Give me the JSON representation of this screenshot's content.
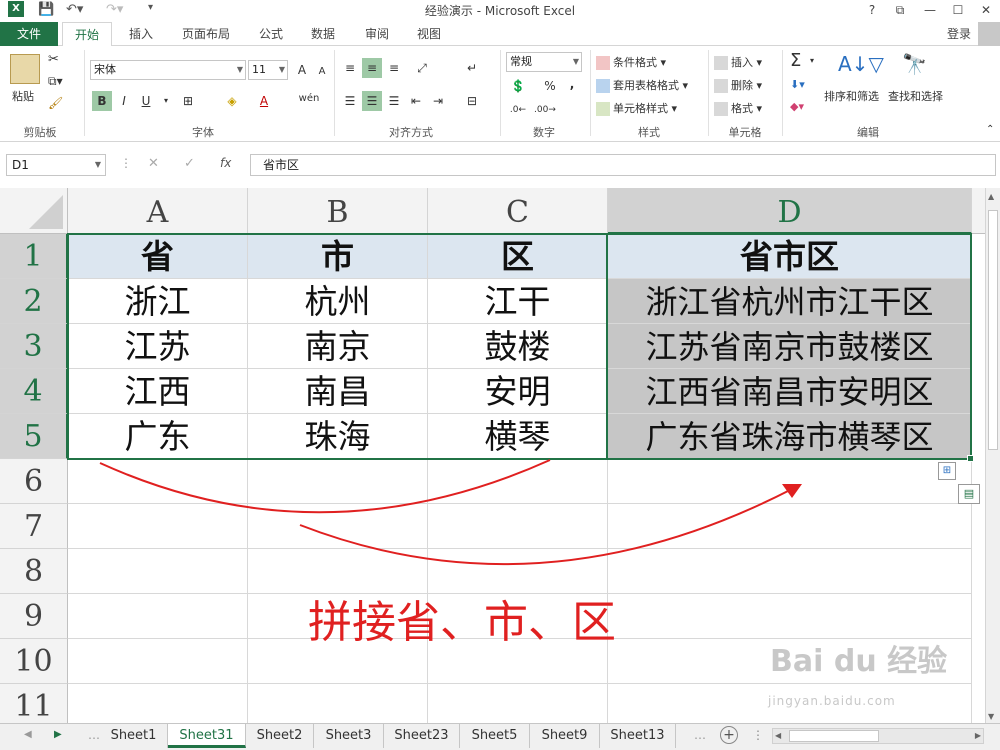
{
  "app": {
    "title": "经验演示 - Microsoft Excel",
    "login": "登录",
    "help": "?",
    "restore": "⧉",
    "minimize": "—",
    "close": "✕"
  },
  "tabs": [
    "文件",
    "开始",
    "插入",
    "页面布局",
    "公式",
    "数据",
    "审阅",
    "视图"
  ],
  "ribbon": {
    "clipboard": {
      "paste": "粘贴",
      "label": "剪贴板"
    },
    "font": {
      "name": "宋体",
      "size": "11",
      "grow": "A",
      "shrink": "A",
      "bold": "B",
      "italic": "I",
      "underline": "U",
      "fontcolor": "A",
      "phonetic": "wén",
      "label": "字体"
    },
    "alignment": {
      "label": "对齐方式"
    },
    "number": {
      "format": "常规",
      "percent": "%",
      "comma": ",",
      "label": "数字"
    },
    "styles": {
      "cond": "条件格式",
      "table": "套用表格格式",
      "cell": "单元格样式",
      "label": "样式"
    },
    "cells": {
      "insert": "插入",
      "delete": "删除",
      "format": "格式",
      "label": "单元格"
    },
    "editing": {
      "sum": "Σ",
      "sort": "排序和筛选",
      "find": "查找和选择",
      "label": "编辑"
    }
  },
  "formula_bar": {
    "namebox": "D1",
    "fx": "fx",
    "content": "省市区"
  },
  "columns": [
    "A",
    "B",
    "C",
    "D"
  ],
  "rows": [
    "1",
    "2",
    "3",
    "4",
    "5",
    "6",
    "7",
    "8",
    "9",
    "10",
    "11"
  ],
  "cells": [
    [
      "省",
      "市",
      "区",
      "省市区"
    ],
    [
      "浙江",
      "杭州",
      "江干",
      "浙江省杭州市江干区"
    ],
    [
      "江苏",
      "南京",
      "鼓楼",
      "江苏省南京市鼓楼区"
    ],
    [
      "江西",
      "南昌",
      "安明",
      "江西省南昌市安明区"
    ],
    [
      "广东",
      "珠海",
      "横琴",
      "广东省珠海市横琴区"
    ]
  ],
  "annotation": "拼接省、市、区",
  "watermark": {
    "logo": "Bai du 经验",
    "url": "jingyan.baidu.com"
  },
  "sheets": [
    "Sheet1",
    "Sheet31",
    "Sheet2",
    "Sheet3",
    "Sheet23",
    "Sheet5",
    "Sheet9",
    "Sheet13"
  ],
  "active_sheet": "Sheet31",
  "colors": {
    "accent": "#217346",
    "annotation": "#e02020",
    "header_fill": "#dce6f0",
    "selection_fill": "#c6c6c6"
  }
}
